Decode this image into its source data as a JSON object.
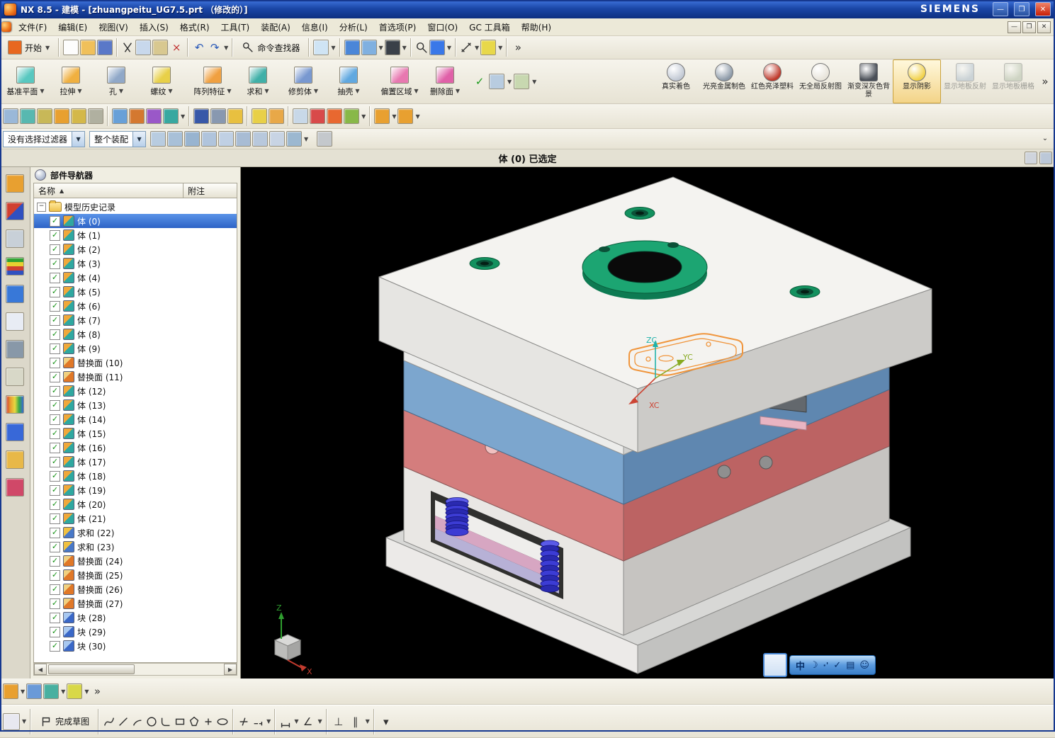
{
  "window": {
    "title": "NX 8.5 - 建模 - [zhuangpeitu_UG7.5.prt （修改的）]",
    "brand": "SIEMENS"
  },
  "menu": {
    "items": [
      "文件(F)",
      "编辑(E)",
      "视图(V)",
      "插入(S)",
      "格式(R)",
      "工具(T)",
      "装配(A)",
      "信息(I)",
      "分析(L)",
      "首选项(P)",
      "窗口(O)",
      "GC 工具箱",
      "帮助(H)"
    ]
  },
  "toolbars": {
    "row1": [
      {
        "name": "start-button",
        "label": "开始",
        "c": "#e8671f",
        "dd": true
      },
      {
        "sep": true
      },
      {
        "name": "new-file-icon",
        "sq": "#fdfdfd"
      },
      {
        "name": "open-icon",
        "sq": "#f0c05a"
      },
      {
        "name": "save-icon",
        "sq": "#5a78c8"
      },
      {
        "sep": true
      },
      {
        "name": "cut-icon",
        "svg": "cut"
      },
      {
        "name": "copy-icon",
        "sq": "#c8d8ec"
      },
      {
        "name": "paste-icon",
        "sq": "#d8c890"
      },
      {
        "name": "delete-icon",
        "glyph": "×",
        "gc": "#c03030"
      },
      {
        "sep": true
      },
      {
        "name": "undo-icon",
        "glyph": "↶",
        "gc": "#2858b8"
      },
      {
        "name": "redo-icon",
        "glyph": "↷",
        "gc": "#2858b8",
        "dd": true
      },
      {
        "sep": true
      },
      {
        "name": "command-finder-button",
        "label": "命令查找器",
        "svg": "finder"
      },
      {
        "sep": true
      },
      {
        "name": "touch-mode-icon",
        "sq": "#cfe4f4",
        "dd": true
      },
      {
        "sep": true
      },
      {
        "name": "window-grid-icon",
        "sq": "#4a86d8"
      },
      {
        "name": "view-cube-icon",
        "sq": "#80b0e0",
        "dd": true
      },
      {
        "name": "display-mode-icon",
        "sq": "#3a4048",
        "dd": true
      },
      {
        "sep": true
      },
      {
        "name": "zoom-icon",
        "svg": "zoom"
      },
      {
        "name": "orient-view-icon",
        "sq": "#3a78e8",
        "dd": true
      },
      {
        "sep": true
      },
      {
        "name": "measure-icon",
        "svg": "measure",
        "dd": true
      },
      {
        "name": "ruler-icon",
        "sq": "#e8d84a",
        "dd": true
      },
      {
        "sep": true
      },
      {
        "name": "toolbar-overflow-chevron",
        "glyph": "»"
      }
    ],
    "row3": [
      {
        "name": "sketch-in-task-icon",
        "sq": "#9ab8d8"
      },
      {
        "name": "datum-small-icon",
        "sq": "#58b8b0"
      },
      {
        "name": "layers-small-icon",
        "sq": "#c8b858"
      },
      {
        "name": "open-part-icon",
        "sq": "#e8a030"
      },
      {
        "name": "paint-format-icon",
        "sq": "#d4b84a"
      },
      {
        "name": "key-icon",
        "sq": "#b0b0a0"
      },
      {
        "sep": true
      },
      {
        "name": "pan-icon",
        "sq": "#68a0d8"
      },
      {
        "name": "zoom-in-icon",
        "sq": "#d47830"
      },
      {
        "name": "fit-view-icon",
        "sq": "#9a58c8"
      },
      {
        "name": "rotate-view-icon",
        "sq": "#38a8a0",
        "dd": true
      },
      {
        "sep": true
      },
      {
        "name": "shaded-ball-icon",
        "sq": "#3858a8"
      },
      {
        "name": "wireframe-ball-icon",
        "sq": "#8898b0"
      },
      {
        "name": "studio-ball-icon",
        "sq": "#e8c040"
      },
      {
        "sep": true
      },
      {
        "name": "cylinder-tool-icon",
        "sq": "#e8d048"
      },
      {
        "name": "sphere-tool-icon",
        "sq": "#e8a848"
      },
      {
        "sep": true
      },
      {
        "name": "triangle-mesh-icon",
        "sq": "#c8d8e8"
      },
      {
        "name": "section-view-icon",
        "sq": "#d84a4a"
      },
      {
        "name": "target-point-icon",
        "sq": "#e86830"
      },
      {
        "name": "synchronous-icon",
        "sq": "#88b848",
        "dd": true
      },
      {
        "sep": true
      },
      {
        "name": "barrel-a-icon",
        "sq": "#e8a030",
        "dd": true
      },
      {
        "name": "barrel-b-icon",
        "sq": "#e8a030",
        "dd": true
      }
    ],
    "selection_icons": [
      {
        "name": "snap-point-icon",
        "sq": "#b8cce0"
      },
      {
        "name": "snap-end-icon",
        "sq": "#a8c0d8"
      },
      {
        "name": "snap-mid-icon",
        "sq": "#98b4d0"
      },
      {
        "name": "snap-intersection-icon",
        "sq": "#b0c4dc"
      },
      {
        "name": "snap-arc-center-icon",
        "sq": "#c0d0e4"
      },
      {
        "name": "snap-quadrant-icon",
        "sq": "#a8bcd4"
      },
      {
        "name": "snap-existing-point-icon",
        "sq": "#b8c8dc"
      },
      {
        "name": "snap-face-icon",
        "sq": "#c8d4e4"
      },
      {
        "name": "snap-grid-icon",
        "sq": "#9cb8d0",
        "dd": true
      },
      {
        "sep": true
      },
      {
        "name": "selection-extra-icon",
        "sq": "#c4c8cc"
      }
    ],
    "bottom_small": [
      {
        "name": "add-to-group-icon",
        "sq": "#e8a030",
        "dd": true
      },
      {
        "name": "navigator-table-icon",
        "sq": "#6a9ad8"
      },
      {
        "name": "swap-panel-icon",
        "sq": "#48b0a0",
        "dd": true
      },
      {
        "name": "export-list-icon",
        "sq": "#d8d848",
        "dd": true
      },
      {
        "name": "panel-more-chevron",
        "glyph": "»"
      }
    ],
    "sketch_row": [
      {
        "name": "sketch-task-icon",
        "sq": "#e8e8f0",
        "dd": true
      },
      {
        "sep": true
      },
      {
        "name": "finish-sketch-button",
        "label": "完成草图",
        "svg": "flag"
      },
      {
        "sep": true
      },
      {
        "name": "profile-spline-icon",
        "svg": "spline"
      },
      {
        "name": "line-icon",
        "svg": "line"
      },
      {
        "name": "arc-icon",
        "svg": "arc"
      },
      {
        "name": "circle-icon",
        "svg": "circle"
      },
      {
        "name": "fillet-icon",
        "svg": "fillet"
      },
      {
        "name": "rectangle-icon",
        "svg": "rect"
      },
      {
        "name": "polygon-icon",
        "svg": "poly"
      },
      {
        "name": "point-icon",
        "svg": "point"
      },
      {
        "name": "ellipse-icon",
        "svg": "ellipse"
      },
      {
        "sep": true
      },
      {
        "name": "quick-trim-icon",
        "svg": "trim"
      },
      {
        "name": "quick-extend-icon",
        "svg": "extend",
        "dd": true
      },
      {
        "sep": true
      },
      {
        "name": "rapid-dimension-icon",
        "svg": "dim",
        "dd": true
      },
      {
        "name": "angle-dimension-icon",
        "glyph": "∠",
        "dd": true
      },
      {
        "sep": true
      },
      {
        "name": "perpendicular-constraint-icon",
        "glyph": "⊥"
      },
      {
        "name": "parallel-constraint-icon",
        "glyph": "∥",
        "dd": true
      },
      {
        "sep": true
      },
      {
        "name": "more-sketch-tools-icon",
        "glyph": "▾"
      }
    ],
    "rail": [
      {
        "name": "assembly-navigator-icon",
        "sq": "#e8a030"
      },
      {
        "name": "constraint-navigator-icon",
        "sq": "linear-gradient(135deg,#d04030 50%,#3050c0 50%)"
      },
      {
        "name": "part-navigator-icon",
        "sq": "#c8d0d8"
      },
      {
        "name": "layers-palette-icon",
        "sq": "linear-gradient(180deg,#30a030 25%,#e8d030 25%,#e8d030 50%,#d04030 50%,#d04030 75%,#3050c0 75%)"
      },
      {
        "name": "info-icon",
        "sq": "#3878d8"
      },
      {
        "name": "internet-explorer-icon",
        "sq": "#e8ecf4"
      },
      {
        "name": "history-icon",
        "sq": "#8898a8"
      },
      {
        "name": "system-materials-icon",
        "sq": "#d8d8c8"
      },
      {
        "name": "palette-icon",
        "sq": "linear-gradient(90deg,#d04030,#e8a030,#e8d840,#38a848,#3868d8)"
      },
      {
        "name": "roles-icon",
        "sq": "#3868d8"
      },
      {
        "name": "people-icon",
        "sq": "#e8b848"
      },
      {
        "name": "touch-panel-icon",
        "sq": "#d04868"
      }
    ]
  },
  "feature_toolbar": {
    "buttons": [
      {
        "label": "基准平面",
        "c": "#58c8c0",
        "dd": true
      },
      {
        "label": "拉伸",
        "c": "#f0b040",
        "dd": true
      },
      {
        "label": "孔",
        "c": "#90a8c8",
        "dd": true
      },
      {
        "label": "螺纹",
        "c": "#e8d048",
        "dd": true
      },
      {
        "label": "阵列特征",
        "c": "#f0a040",
        "dd": true
      },
      {
        "label": "求和",
        "c": "#40b0a8",
        "dd": true
      },
      {
        "label": "修剪体",
        "c": "#7898d0",
        "dd": true
      },
      {
        "label": "抽壳",
        "c": "#60a8e0",
        "dd": true
      },
      {
        "label": "偏置区域",
        "c": "#e878b0",
        "dd": true
      },
      {
        "label": "删除面",
        "c": "#e060a8",
        "dd": true
      }
    ],
    "extras": [
      {
        "name": "part-check-icon",
        "glyph": "✓",
        "gc": "#1a9a1a"
      },
      {
        "name": "feature-table-icon",
        "sq": "#b8cce0",
        "dd": true
      },
      {
        "name": "group-table-icon",
        "sq": "#c8d8b0",
        "dd": true
      }
    ]
  },
  "render_toolbar": {
    "buttons": [
      {
        "label": "真实着色",
        "c": "#c2c9d4",
        "shape": "sphere"
      },
      {
        "label": "光亮金属制色",
        "c": "#8d9aa8",
        "shape": "sphere"
      },
      {
        "label": "红色亮泽塑料",
        "c": "#c0392b",
        "shape": "sphere"
      },
      {
        "label": "无全局反射图",
        "c": "#e8e4da",
        "shape": "sphere"
      },
      {
        "label": "渐变深灰色背景",
        "c": "#4a4f57",
        "shape": "box"
      },
      {
        "label": "显示阴影",
        "c": "#f2d24a",
        "shape": "sphere",
        "active": true
      },
      {
        "label": "显示地板反射",
        "c": "#9fb4c8",
        "shape": "box",
        "disabled": true
      },
      {
        "label": "显示地板栅格",
        "c": "#a8b8a0",
        "shape": "box",
        "disabled": true
      }
    ]
  },
  "selection_bar": {
    "filter_value": "没有选择过滤器",
    "scope_value": "整个装配"
  },
  "cue_bar": {
    "message": "体 (0) 已选定"
  },
  "navigator": {
    "title": "部件导航器",
    "name_column": "名称",
    "note_column": "附注",
    "root_label": "模型历史记录",
    "items": [
      {
        "label": "体 (0)",
        "type": "body",
        "selected": true
      },
      {
        "label": "体 (1)",
        "type": "body"
      },
      {
        "label": "体 (2)",
        "type": "body"
      },
      {
        "label": "体 (3)",
        "type": "body"
      },
      {
        "label": "体 (4)",
        "type": "body"
      },
      {
        "label": "体 (5)",
        "type": "body"
      },
      {
        "label": "体 (6)",
        "type": "body"
      },
      {
        "label": "体 (7)",
        "type": "body"
      },
      {
        "label": "体 (8)",
        "type": "body"
      },
      {
        "label": "体 (9)",
        "type": "body"
      },
      {
        "label": "替换面 (10)",
        "type": "replace"
      },
      {
        "label": "替换面 (11)",
        "type": "replace"
      },
      {
        "label": "体 (12)",
        "type": "body"
      },
      {
        "label": "体 (13)",
        "type": "body"
      },
      {
        "label": "体 (14)",
        "type": "body"
      },
      {
        "label": "体 (15)",
        "type": "body"
      },
      {
        "label": "体 (16)",
        "type": "body"
      },
      {
        "label": "体 (17)",
        "type": "body"
      },
      {
        "label": "体 (18)",
        "type": "body"
      },
      {
        "label": "体 (19)",
        "type": "body"
      },
      {
        "label": "体 (20)",
        "type": "body"
      },
      {
        "label": "体 (21)",
        "type": "body"
      },
      {
        "label": "求和 (22)",
        "type": "unite"
      },
      {
        "label": "求和 (23)",
        "type": "unite"
      },
      {
        "label": "替换面 (24)",
        "type": "replace"
      },
      {
        "label": "替换面 (25)",
        "type": "replace"
      },
      {
        "label": "替换面 (26)",
        "type": "replace"
      },
      {
        "label": "替换面 (27)",
        "type": "replace"
      },
      {
        "label": "块 (28)",
        "type": "block"
      },
      {
        "label": "块 (29)",
        "type": "block"
      },
      {
        "label": "块 (30)",
        "type": "block"
      }
    ]
  },
  "viewport": {
    "axis": {
      "zc": "ZC",
      "yc": "YC",
      "xc": "XC"
    },
    "triad": {
      "z": "Z",
      "x": "X"
    },
    "colors": {
      "top_plate": "#f4f3f0",
      "a_plate": "#7ca6ce",
      "b_plate": "#d47d7d",
      "ring": "#1ca572",
      "spring": "#3c3cd4",
      "sketch": "#f0953c"
    }
  },
  "ime": {
    "lang": "中"
  }
}
